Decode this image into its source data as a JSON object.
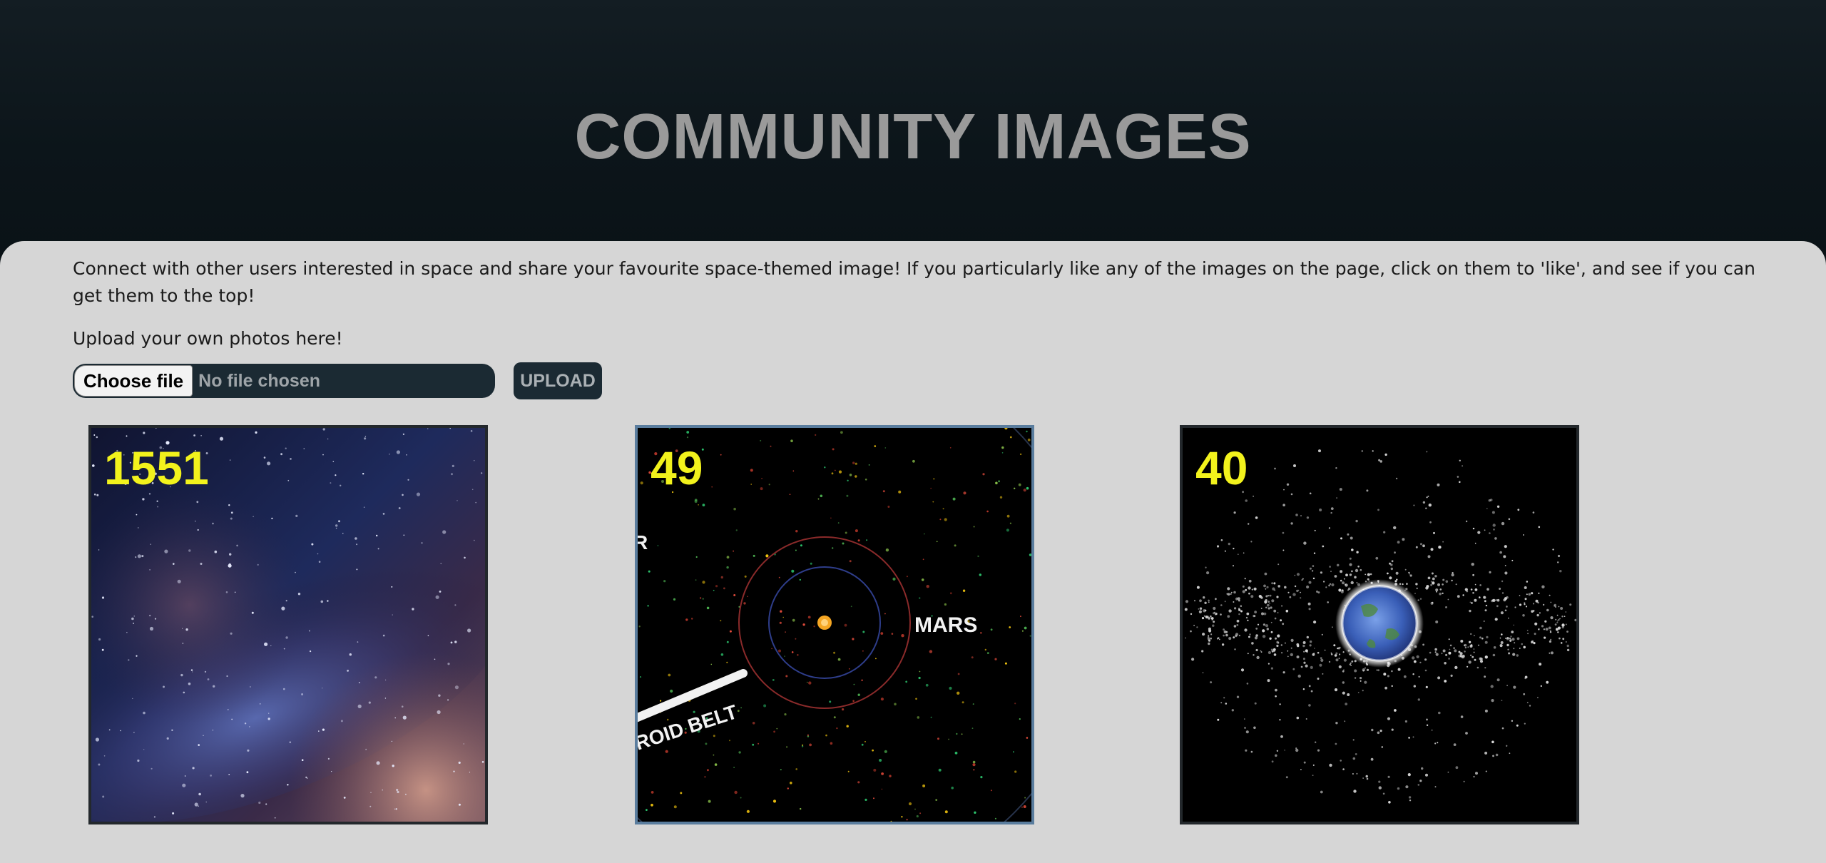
{
  "header": {
    "title": "COMMUNITY IMAGES"
  },
  "intro": {
    "text": "Connect with other users interested in space and share your favourite space-themed image! If you particularly like any of the images on the page, click on them to 'like', and see if you can get them to the top!"
  },
  "upload": {
    "label": "Upload your own photos here!",
    "choose_label": "Choose file",
    "file_status": "No file chosen",
    "button_label": "UPLOAD"
  },
  "gallery": {
    "images": [
      {
        "likes": "1551",
        "description_icon": "milky-way-image"
      },
      {
        "likes": "49",
        "description_icon": "solar-system-map-image",
        "labels": [
          "MARS",
          "ROID BELT",
          "R"
        ]
      },
      {
        "likes": "40",
        "description_icon": "earth-orbit-debris-image"
      }
    ]
  },
  "colors": {
    "likes_text": "#f2f21c",
    "panel_bg": "#d6d6d6",
    "button_bg": "#1b2a33",
    "selected_border": "#5a7d9e"
  }
}
